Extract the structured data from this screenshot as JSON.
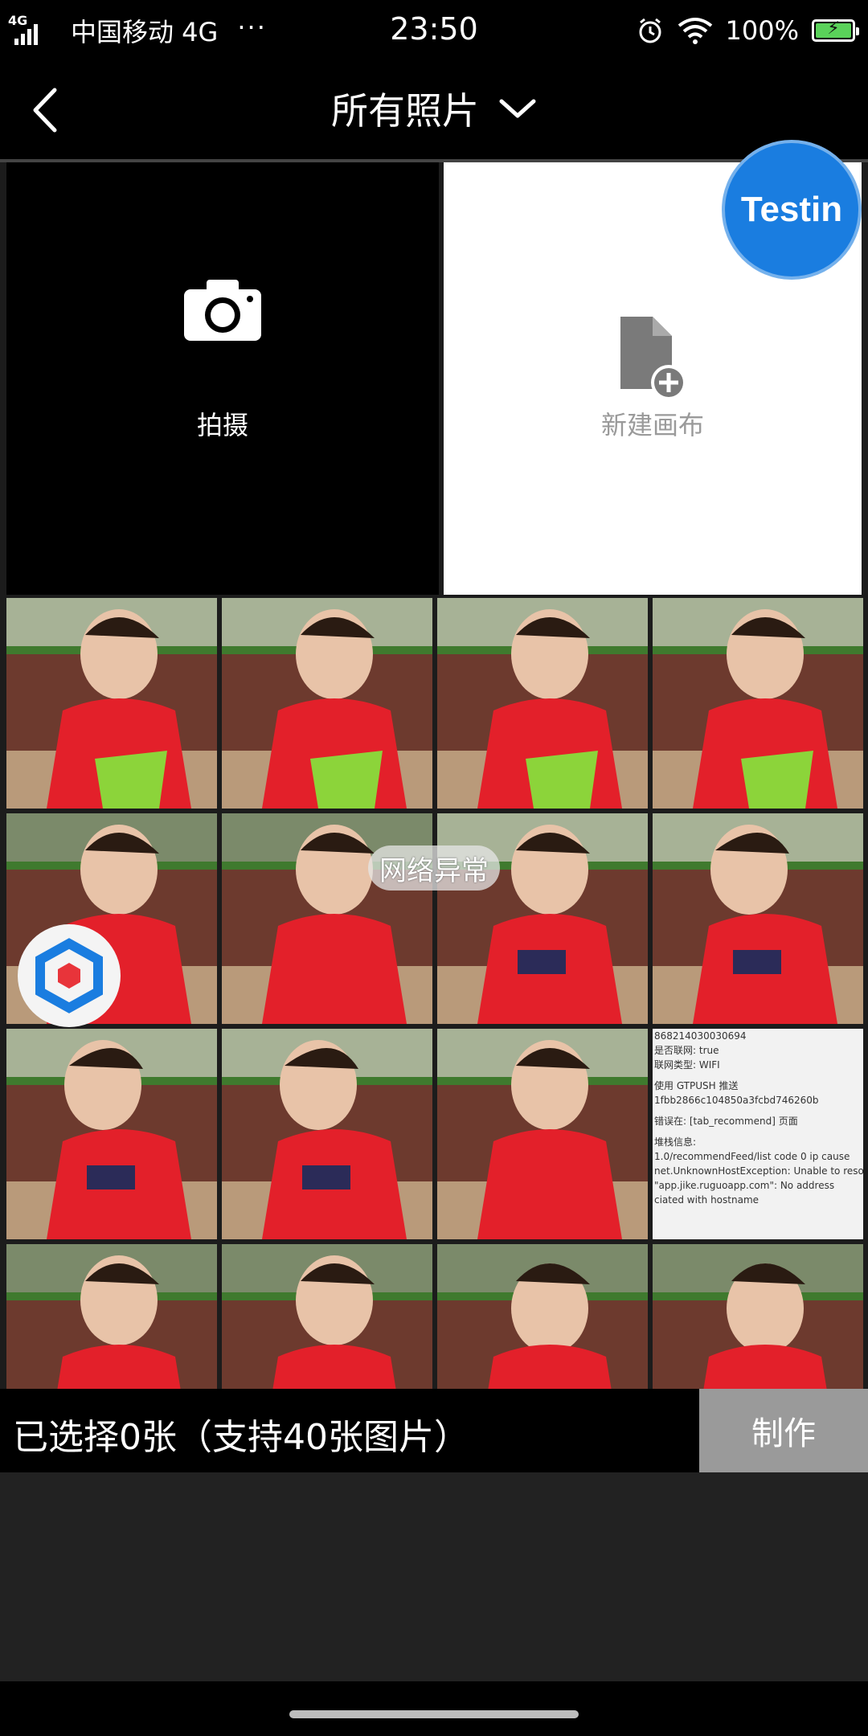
{
  "status_bar": {
    "network_label": "4G",
    "carrier": "中国移动 4G",
    "time": "23:50",
    "battery_pct": "100%",
    "battery_fill": 1.0,
    "more": "···"
  },
  "header": {
    "title": "所有照片"
  },
  "tiles": {
    "camera_label": "拍摄",
    "canvas_label": "新建画布"
  },
  "photos": [
    {
      "id": "p1"
    },
    {
      "id": "p2"
    },
    {
      "id": "p3"
    },
    {
      "id": "p4"
    },
    {
      "id": "p5"
    },
    {
      "id": "p6"
    },
    {
      "id": "p7"
    },
    {
      "id": "p8"
    },
    {
      "id": "p9"
    },
    {
      "id": "p10"
    },
    {
      "id": "p11"
    },
    {
      "id": "p12"
    },
    {
      "id": "p13"
    },
    {
      "id": "p14"
    },
    {
      "id": "p15"
    },
    {
      "id": "p16"
    }
  ],
  "screenshot_lines": [
    "868214030030694",
    "是否联网: true",
    "联网类型: WIFI",
    "使用 GTPUSH 推送",
    "1fbb2866c104850a3fcbd746260b",
    "错误在: [tab_recommend] 页面",
    "堆栈信息:",
    "1.0/recommendFeed/list code 0 ip  cause",
    "net.UnknownHostException: Unable to reso",
    "\"app.jike.ruguoapp.com\": No address",
    "ciated with hostname"
  ],
  "bottom_bar": {
    "selected_text": "已选择0张（支持40张图片）",
    "make_button": "制作"
  },
  "overlays": {
    "testin_label": "Testin",
    "toast_text": "网络异常"
  },
  "colors": {
    "accent_blue": "#1a7de0",
    "make_button_bg": "#9a9a9a",
    "shirt_red": "#e3202a",
    "bucket_green": "#8cd43a"
  }
}
